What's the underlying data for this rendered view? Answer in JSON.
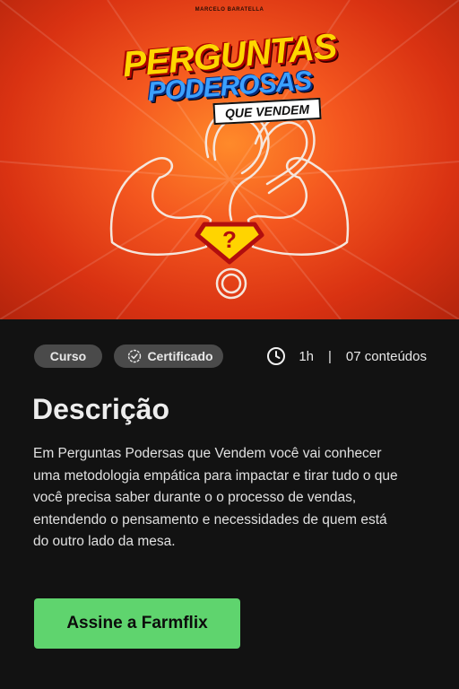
{
  "hero": {
    "author": "MARCELO BARATELLA",
    "title_line1": "PERGUNTAS",
    "title_line2": "PODEROSAS",
    "subtitle": "QUE VENDEM",
    "badge_symbol": "?",
    "colors": {
      "background": "#f4571f",
      "title_yellow": "#ffd600",
      "title_blue": "#3aa0ff"
    }
  },
  "meta": {
    "type_chip": "Curso",
    "certificate_chip": "Certificado",
    "certificate_icon": "check-circle-icon",
    "clock_icon": "clock-icon",
    "duration": "1h",
    "separator": "|",
    "contents": "07 conteúdos"
  },
  "description": {
    "heading": "Descrição",
    "text": "Em Perguntas Podersas que Vendem você vai conhecer uma metodologia empática para impactar e tirar tudo o que você precisa saber durante o o processo de vendas, entendendo o pensamento e necessidades de quem está do outro lado da mesa."
  },
  "cta": {
    "label": "Assine a Farmflix",
    "color": "#5fd46e"
  }
}
